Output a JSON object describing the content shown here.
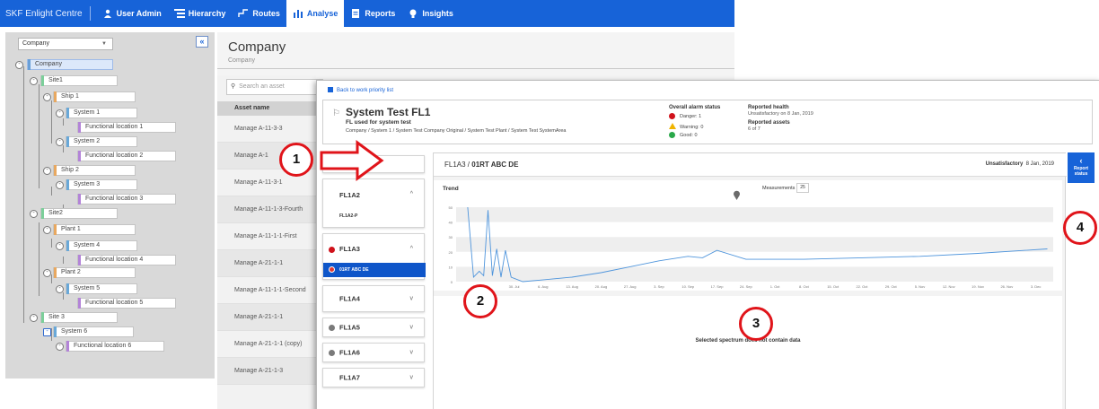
{
  "nav": {
    "brand": "SKF Enlight Centre",
    "items": [
      {
        "label": "User Admin",
        "icon": "user-icon",
        "active": false
      },
      {
        "label": "Hierarchy",
        "icon": "hierarchy-icon",
        "active": false
      },
      {
        "label": "Routes",
        "icon": "routes-icon",
        "active": false
      },
      {
        "label": "Analyse",
        "icon": "analyse-icon",
        "active": true
      },
      {
        "label": "Reports",
        "icon": "reports-icon",
        "active": false
      },
      {
        "label": "Insights",
        "icon": "insights-icon",
        "active": false
      }
    ]
  },
  "tree": {
    "selector_value": "Company",
    "collapse_label": "«",
    "nodes": [
      {
        "label": "Company",
        "level": 0
      },
      {
        "label": "Site1",
        "level": 1
      },
      {
        "label": "Ship 1",
        "level": 2
      },
      {
        "label": "System 1",
        "level": 3
      },
      {
        "label": "Functional location 1",
        "level": 4
      },
      {
        "label": "System 2",
        "level": 3
      },
      {
        "label": "Functional location 2",
        "level": 4
      },
      {
        "label": "Ship 2",
        "level": 2
      },
      {
        "label": "System 3",
        "level": 3
      },
      {
        "label": "Functional location 3",
        "level": 4
      },
      {
        "label": "Site2",
        "level": 1
      },
      {
        "label": "Plant 1",
        "level": 2
      },
      {
        "label": "System 4",
        "level": 3
      },
      {
        "label": "Functional location 4",
        "level": 4
      },
      {
        "label": "Plant 2",
        "level": 2
      },
      {
        "label": "System 5",
        "level": 3
      },
      {
        "label": "Functional location 5",
        "level": 4
      },
      {
        "label": "Site 3",
        "level": 1
      },
      {
        "label": "System 6",
        "level": 2
      },
      {
        "label": "Functional location 6",
        "level": 3
      }
    ]
  },
  "company": {
    "title": "Company",
    "subtitle": "Company"
  },
  "assets": {
    "search_placeholder": "Search an asset",
    "header": "Asset name",
    "rows": [
      "Manage A-11-3-3",
      "Manage A-1",
      "Manage A-11-3-1",
      "Manage A-11-1-3-Fourth",
      "Manage A-11-1-1-First",
      "Manage A-21-1-1",
      "Manage A-11-1-1-Second",
      "Manage A-21-1-1",
      "Manage A-21-1-1 (copy)",
      "Manage A-21-1-3"
    ]
  },
  "detail": {
    "back_link": "Back to work priority list",
    "fl_title": "System Test FL1",
    "fl_subtitle": "FL used for system test",
    "fl_path": "Company / System 1 / System Test Company Original / System Test Plant / System Test SystemArea",
    "alarm": {
      "heading": "Overall alarm status",
      "danger": "Danger: 1",
      "warning": "Warning: 0",
      "good": "Good: 0"
    },
    "health": {
      "heading": "Reported health",
      "value": "Unsatisfactory on 8 Jan, 2019",
      "assets_heading": "Reported assets",
      "assets_value": "6 of 7"
    },
    "fl_items": [
      {
        "label": "FL1A2",
        "chevron": "^",
        "alarm": false
      },
      {
        "label": "FL1A3",
        "chevron": "^",
        "alarm": true
      },
      {
        "label": "FL1A4",
        "chevron": "v",
        "alarm": false
      },
      {
        "label": "FL1A5",
        "chevron": "v",
        "alarm": false
      },
      {
        "label": "FL1A6",
        "chevron": "v",
        "alarm": false
      },
      {
        "label": "FL1A7",
        "chevron": "v",
        "alarm": false
      }
    ],
    "fl1a2_sub": "FL1A2-P",
    "selected_point": "01RT ABC DE",
    "chart_path_prefix": "FL1A3 / ",
    "chart_path_point": "01RT ABC DE",
    "chart_status_label": "Unsatisfactory",
    "chart_status_date": "8 Jan, 2019",
    "trend_label": "Trend",
    "measurements_label": "Measurements",
    "measurements_value": "25",
    "empty_message": "Selected spectrum does not contain data",
    "report_button": "Report status"
  },
  "chart_data": {
    "type": "line",
    "y_ticks": [
      0,
      10,
      20,
      30,
      40,
      50
    ],
    "ylim": [
      0,
      50
    ],
    "x_labels": [
      "30. Jul",
      "6. Aug",
      "13. Aug",
      "20. Aug",
      "27. Aug",
      "3. Sep",
      "10. Sep",
      "17. Sep",
      "24. Sep",
      "1. Oct",
      "8. Oct",
      "15. Oct",
      "22. Oct",
      "29. Oct",
      "5. Nov",
      "12. Nov",
      "19. Nov",
      "26. Nov",
      "3. Dec"
    ],
    "series": [
      {
        "x": [
          -1.6,
          -1.4,
          -1.2,
          -1.05,
          -0.9,
          -0.75,
          -0.6,
          -0.45,
          -0.3,
          -0.1,
          0.3,
          0.9,
          2,
          3,
          4,
          5,
          6,
          6.5,
          7,
          8,
          10,
          12,
          14,
          16,
          18.4
        ],
        "y": [
          50,
          3,
          7,
          4,
          48,
          4,
          22,
          3,
          21,
          3,
          0,
          1,
          3,
          6,
          10,
          14,
          17,
          16,
          21,
          15,
          15,
          16,
          17,
          19,
          22
        ]
      }
    ]
  },
  "annotations": [
    "1",
    "2",
    "3",
    "4"
  ]
}
